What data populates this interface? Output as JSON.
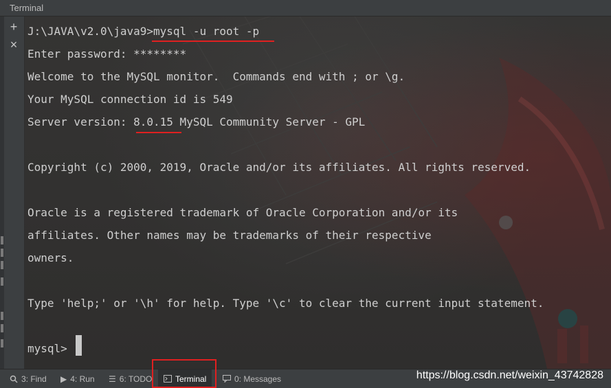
{
  "window": {
    "title": "Terminal"
  },
  "gutter": {
    "add_icon": "+",
    "close_icon": "×"
  },
  "terminal": {
    "lines": [
      "J:\\JAVA\\v2.0\\java9>mysql -u root -p",
      "Enter password: ********",
      "Welcome to the MySQL monitor.  Commands end with ; or \\g.",
      "Your MySQL connection id is 549",
      "Server version: 8.0.15 MySQL Community Server - GPL",
      "",
      "Copyright (c) 2000, 2019, Oracle and/or its affiliates. All rights reserved.",
      "",
      "Oracle is a registered trademark of Oracle Corporation and/or its",
      "affiliates. Other names may be trademarks of their respective",
      "owners.",
      "",
      "Type 'help;' or '\\h' for help. Type '\\c' to clear the current input statement.",
      "",
      "mysql> "
    ]
  },
  "status_bar": {
    "tabs": [
      {
        "icon": "search-icon",
        "label": "3: Find"
      },
      {
        "icon": "play-icon",
        "label": "4: Run"
      },
      {
        "icon": "list-icon",
        "label": "6: TODO"
      },
      {
        "icon": "terminal-icon",
        "label": "Terminal",
        "active": true
      },
      {
        "icon": "message-icon",
        "label": "0: Messages"
      }
    ],
    "watermark": "https://blog.csdn.net/weixin_43742828"
  },
  "colors": {
    "annotation_red": "#e02020",
    "terminal_text": "#cfcfcf",
    "chrome": "#3c3f41"
  }
}
